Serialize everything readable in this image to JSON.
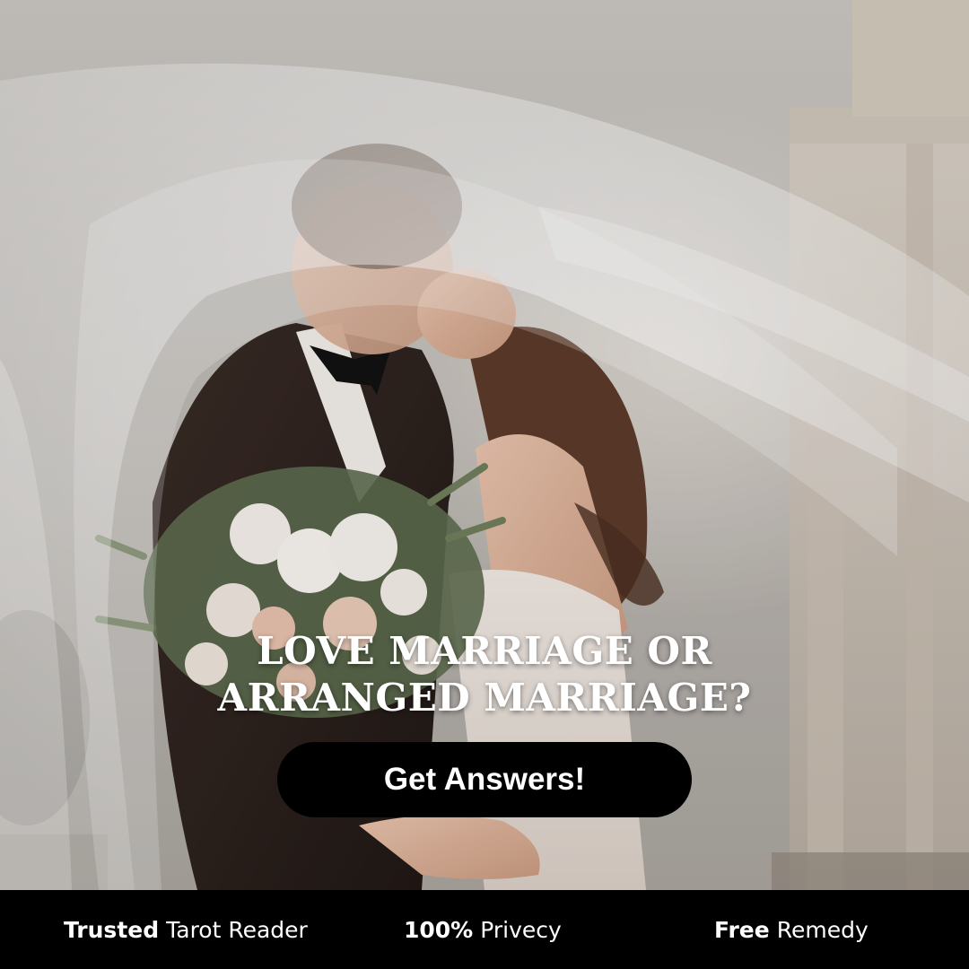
{
  "headline": {
    "line1": "LOVE MARRIAGE OR",
    "line2": "ARRANGED MARRIAGE?"
  },
  "cta": {
    "label": "Get Answers!"
  },
  "features": [
    {
      "bold": "Trusted",
      "text": "Tarot Reader"
    },
    {
      "bold": "100%",
      "text": "Privecy"
    },
    {
      "bold": "Free",
      "text": "Remedy"
    }
  ],
  "colors": {
    "button_bg": "#000000",
    "footer_bg": "#000000",
    "text": "#ffffff"
  }
}
